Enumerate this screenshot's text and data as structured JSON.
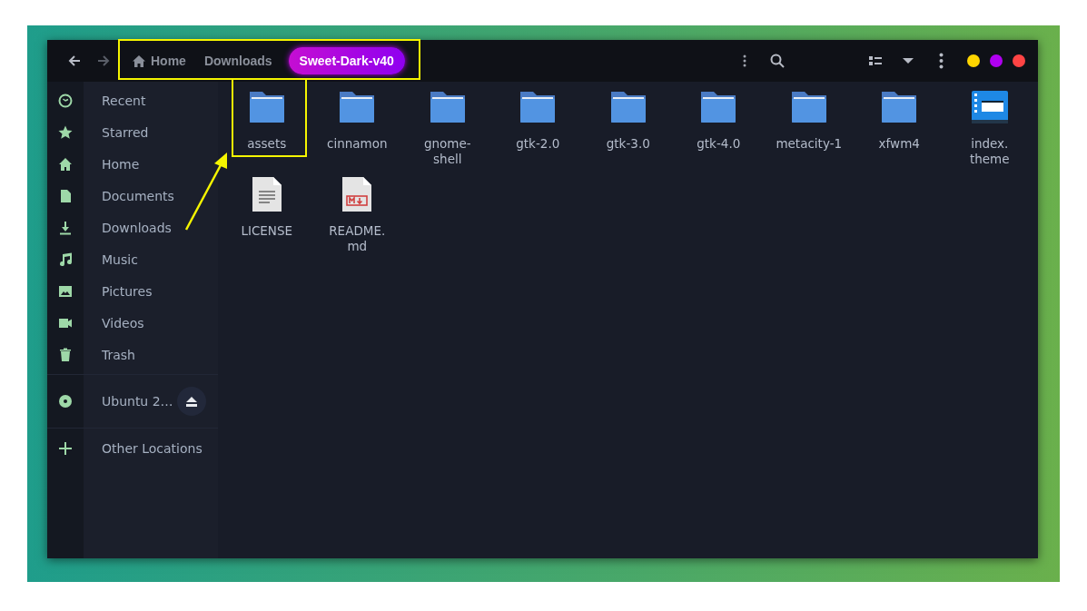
{
  "breadcrumbs": [
    {
      "kind": "home",
      "label": "Home",
      "selected": false
    },
    {
      "kind": "folder",
      "label": "Downloads",
      "selected": false
    },
    {
      "kind": "folder",
      "label": "Sweet-Dark-v40",
      "selected": true
    }
  ],
  "window_controls": [
    {
      "color": "#ffd500"
    },
    {
      "color": "#b000f0"
    },
    {
      "color": "#ff4444"
    }
  ],
  "sidebar": {
    "places": [
      {
        "label": "Recent"
      },
      {
        "label": "Starred"
      },
      {
        "label": "Home"
      },
      {
        "label": "Documents"
      },
      {
        "label": "Downloads"
      },
      {
        "label": "Music"
      },
      {
        "label": "Pictures"
      },
      {
        "label": "Videos"
      },
      {
        "label": "Trash"
      }
    ],
    "devices": [
      {
        "label": "Ubuntu 2…"
      }
    ],
    "other": [
      {
        "label": "Other Locations"
      }
    ]
  },
  "files": [
    {
      "kind": "folder",
      "name": "assets"
    },
    {
      "kind": "folder",
      "name": "cinnamon"
    },
    {
      "kind": "folder",
      "name": "gnome-\nshell"
    },
    {
      "kind": "folder",
      "name": "gtk-2.0"
    },
    {
      "kind": "folder",
      "name": "gtk-3.0"
    },
    {
      "kind": "folder",
      "name": "gtk-4.0"
    },
    {
      "kind": "folder",
      "name": "metacity-1"
    },
    {
      "kind": "folder",
      "name": "xfwm4"
    },
    {
      "kind": "theme",
      "name": "index.\ntheme"
    },
    {
      "kind": "text",
      "name": "LICENSE"
    },
    {
      "kind": "markdown",
      "name": "README.\nmd"
    }
  ]
}
